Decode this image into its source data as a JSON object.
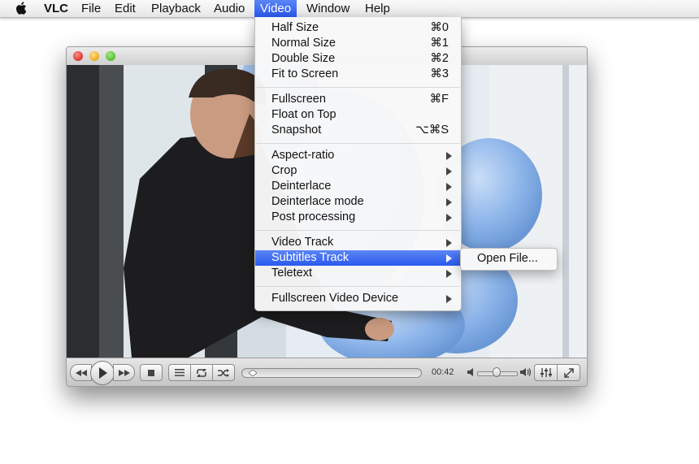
{
  "menubar": {
    "items": [
      {
        "label": "VLC"
      },
      {
        "label": "File"
      },
      {
        "label": "Edit"
      },
      {
        "label": "Playback"
      },
      {
        "label": "Audio"
      },
      {
        "label": "Video"
      },
      {
        "label": "Window"
      },
      {
        "label": "Help"
      }
    ],
    "active": "Video"
  },
  "video_menu": {
    "groups": [
      [
        {
          "label": "Half Size",
          "shortcut": "⌘0"
        },
        {
          "label": "Normal Size",
          "shortcut": "⌘1"
        },
        {
          "label": "Double Size",
          "shortcut": "⌘2"
        },
        {
          "label": "Fit to Screen",
          "shortcut": "⌘3"
        }
      ],
      [
        {
          "label": "Fullscreen",
          "shortcut": "⌘F"
        },
        {
          "label": "Float on Top",
          "shortcut": ""
        },
        {
          "label": "Snapshot",
          "shortcut": "⌥⌘S"
        }
      ],
      [
        {
          "label": "Aspect-ratio",
          "submenu": true
        },
        {
          "label": "Crop",
          "submenu": true
        },
        {
          "label": "Deinterlace",
          "submenu": true
        },
        {
          "label": "Deinterlace mode",
          "submenu": true
        },
        {
          "label": "Post processing",
          "submenu": true
        }
      ],
      [
        {
          "label": "Video Track",
          "submenu": true
        },
        {
          "label": "Subtitles Track",
          "submenu": true,
          "highlighted": true
        },
        {
          "label": "Teletext",
          "submenu": true
        }
      ],
      [
        {
          "label": "Fullscreen Video Device",
          "submenu": true
        }
      ]
    ]
  },
  "subtitles_submenu": {
    "items": [
      {
        "label": "Open File..."
      }
    ]
  },
  "player": {
    "time": "00:42",
    "progress": 0.02,
    "volume": 0.5,
    "icons": [
      "rewind-icon",
      "play-icon",
      "fast-forward-icon",
      "stop-icon",
      "playlist-icon",
      "repeat-icon",
      "shuffle-icon",
      "volume-low-icon",
      "volume-high-icon",
      "equalizer-icon",
      "fullscreen-icon"
    ]
  },
  "colors": {
    "highlight": "#3a6cf2",
    "balloon": "#8fb6ea",
    "jacket": "#1d1d1f"
  }
}
